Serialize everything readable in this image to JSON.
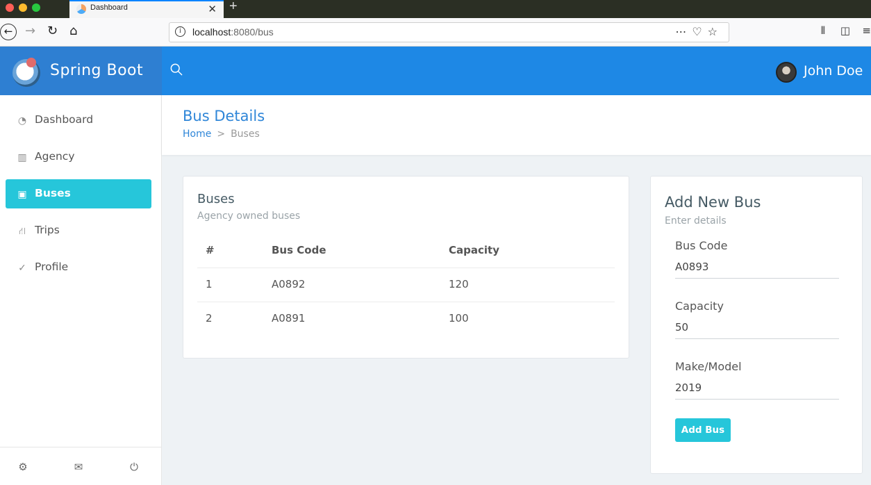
{
  "browser": {
    "tab_title": "Dashboard",
    "tab_close": "✕",
    "new_tab": "+",
    "url_host": "localhost",
    "url_rest": ":8080/bus",
    "icons": [
      "back-icon",
      "forward-icon",
      "reload-icon",
      "home-icon",
      "info-icon",
      "more-icon",
      "pocket-icon",
      "star-icon",
      "library-icon",
      "sidebar-icon",
      "menu-icon"
    ]
  },
  "brand": {
    "name": "Spring Boot"
  },
  "header": {
    "user_name": "John Doe"
  },
  "sidebar": {
    "items": [
      {
        "label": "Dashboard",
        "icon": "dashboard-icon",
        "active": false
      },
      {
        "label": "Agency",
        "icon": "factory-icon",
        "active": false
      },
      {
        "label": "Buses",
        "icon": "bus-icon",
        "active": true
      },
      {
        "label": "Trips",
        "icon": "road-icon",
        "active": false
      },
      {
        "label": "Profile",
        "icon": "user-check-icon",
        "active": false
      }
    ],
    "footer_icons": [
      "gear-icon",
      "mail-icon",
      "power-icon"
    ]
  },
  "page": {
    "title": "Bus Details",
    "breadcrumb": {
      "home": "Home",
      "separator": ">",
      "current": "Buses"
    }
  },
  "buses_card": {
    "title": "Buses",
    "subtitle": "Agency owned buses",
    "columns": [
      "#",
      "Bus Code",
      "Capacity"
    ],
    "rows": [
      [
        "1",
        "A0892",
        "120"
      ],
      [
        "2",
        "A0891",
        "100"
      ]
    ]
  },
  "form": {
    "title": "Add New Bus",
    "subtitle": "Enter details",
    "fields": [
      {
        "label": "Bus Code",
        "value": "A0893"
      },
      {
        "label": "Capacity",
        "value": "50"
      },
      {
        "label": "Make/Model",
        "value": "2019"
      }
    ],
    "submit_label": "Add Bus"
  },
  "colors": {
    "appbar": "#1e88e5",
    "brand_bg": "#2e7fd2",
    "active_item": "#26c6da",
    "title_blue": "#2f86d8"
  }
}
